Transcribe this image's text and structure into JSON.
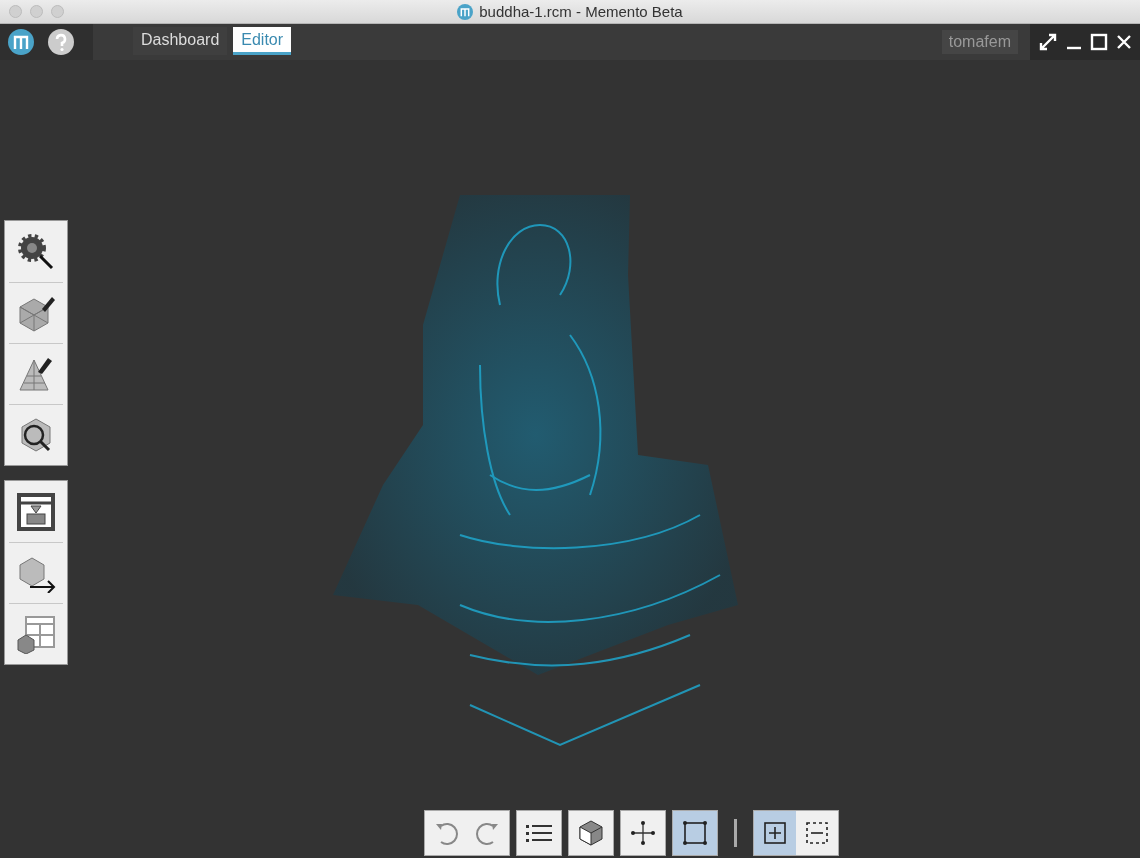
{
  "window": {
    "title": "buddha-1.rcm - Memento Beta"
  },
  "tabs": [
    {
      "label": "Dashboard",
      "selected": false
    },
    {
      "label": "Editor",
      "selected": true
    }
  ],
  "user": "tomafem",
  "tool_groups": [
    {
      "items": [
        {
          "kind": "settings"
        },
        {
          "kind": "edit-mesh"
        },
        {
          "kind": "edit-triangles"
        },
        {
          "kind": "inspect"
        }
      ]
    },
    {
      "items": [
        {
          "kind": "print"
        },
        {
          "kind": "export"
        },
        {
          "kind": "layout"
        }
      ]
    }
  ],
  "bottom_toolbar": [
    {
      "group": [
        {
          "kind": "undo",
          "selected": false
        },
        {
          "kind": "redo",
          "selected": false
        }
      ]
    },
    {
      "group": [
        {
          "kind": "list",
          "selected": false
        }
      ]
    },
    {
      "group": [
        {
          "kind": "cube",
          "selected": false
        }
      ]
    },
    {
      "group": [
        {
          "kind": "move",
          "selected": false
        }
      ]
    },
    {
      "group": [
        {
          "kind": "frame",
          "selected": true
        }
      ]
    },
    {
      "kind": "separator"
    },
    {
      "group": [
        {
          "kind": "add-select",
          "selected": true
        },
        {
          "kind": "remove-select",
          "selected": false
        }
      ]
    }
  ]
}
